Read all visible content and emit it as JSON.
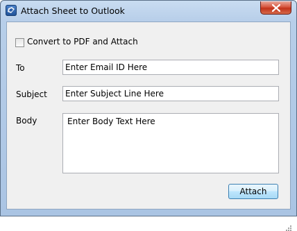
{
  "window": {
    "title": "Attach Sheet to Outlook",
    "icon": "outlook-icon",
    "close_icon": "close-icon"
  },
  "form": {
    "convert_pdf": {
      "label": "Convert to PDF and Attach",
      "checked": false
    },
    "to": {
      "label": "To",
      "value": "Enter Email ID Here"
    },
    "subject": {
      "label": "Subject",
      "value": "Enter Subject Line Here"
    },
    "body": {
      "label": "Body",
      "value": "Enter Body Text Here"
    },
    "attach_label": "Attach"
  }
}
